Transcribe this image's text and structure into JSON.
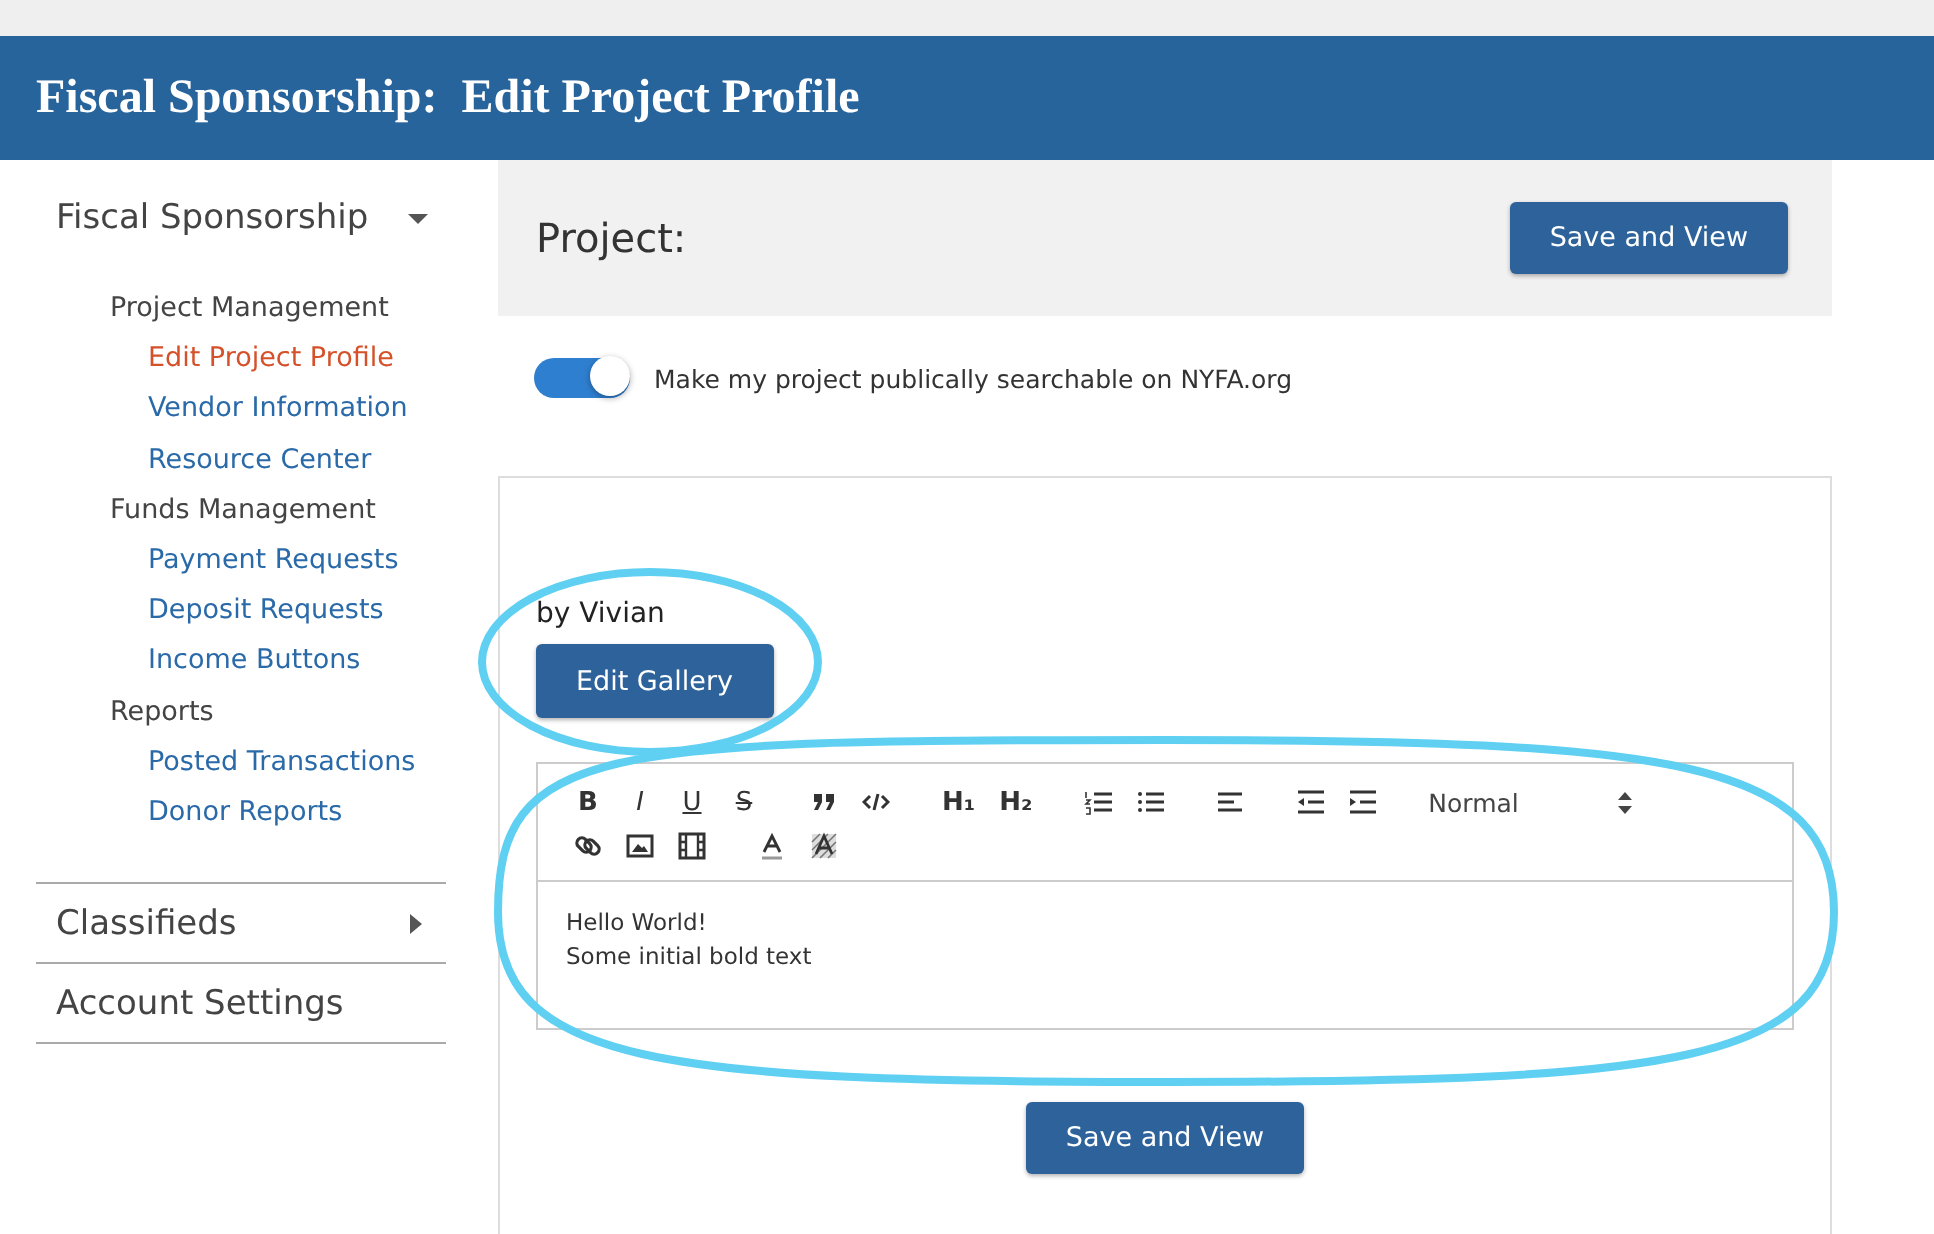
{
  "header": {
    "title": "Fiscal Sponsorship:",
    "subtitle": "Edit Project Profile"
  },
  "sidebar": {
    "section": {
      "label": "Fiscal Sponsorship",
      "expanded": true
    },
    "groups": [
      {
        "label": "Project Management",
        "children": [
          {
            "label": "Edit Project Profile",
            "selected": true
          },
          {
            "label": "Vendor Information",
            "selected": false
          },
          {
            "label": "Resource Center",
            "selected": false
          }
        ]
      },
      {
        "label": "Funds Management",
        "children": [
          {
            "label": "Payment Requests",
            "selected": false
          },
          {
            "label": "Deposit Requests",
            "selected": false
          },
          {
            "label": "Income Buttons",
            "selected": false
          }
        ]
      },
      {
        "label": "Reports",
        "children": [
          {
            "label": "Posted Transactions",
            "selected": false
          },
          {
            "label": "Donor Reports",
            "selected": false
          }
        ]
      }
    ],
    "menus": [
      {
        "label": "Classifieds",
        "kind": "submenu"
      },
      {
        "label": "Account Settings",
        "kind": "link"
      }
    ]
  },
  "project": {
    "title": "Project:",
    "save_button": "Save and View"
  },
  "toggle": {
    "label": "Make my project publically searchable on NYFA.org",
    "on": true
  },
  "byline": "by Vivian",
  "gallery_button": "Edit Gallery",
  "editor": {
    "toolbar": [
      [
        {
          "kind": "bold",
          "label": "B"
        },
        {
          "kind": "italic",
          "label": "I"
        },
        {
          "kind": "underline",
          "label": "U"
        },
        {
          "kind": "strike",
          "label": "S"
        },
        {
          "kind": "quote"
        },
        {
          "kind": "code"
        },
        {
          "kind": "heading",
          "label": "H₁"
        },
        {
          "kind": "heading",
          "label": "H₂"
        },
        {
          "kind": "ordered-list"
        },
        {
          "kind": "bullet-list"
        },
        {
          "kind": "align"
        },
        {
          "kind": "outdent"
        },
        {
          "kind": "indent"
        },
        {
          "kind": "select",
          "label": "Normal"
        }
      ],
      [
        {
          "kind": "link"
        },
        {
          "kind": "image"
        },
        {
          "kind": "video"
        },
        {
          "kind": "color"
        },
        {
          "kind": "background"
        }
      ]
    ],
    "lines": [
      "Hello World!",
      "Some initial bold text"
    ]
  },
  "footer_button": "Save and View"
}
